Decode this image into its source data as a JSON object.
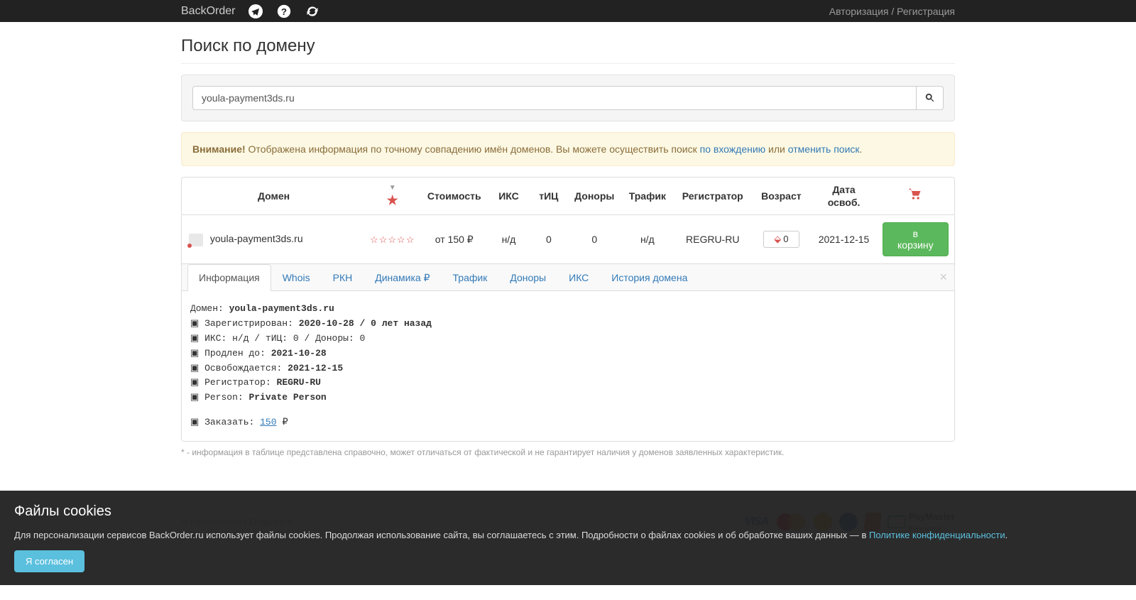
{
  "nav": {
    "brand": "BackOrder",
    "auth": "Авторизация",
    "reg": "Регистрация",
    "sep": " / "
  },
  "page": {
    "title": "Поиск по домену"
  },
  "search": {
    "value": "youla-payment3ds.ru"
  },
  "alert": {
    "strong": "Внимание!",
    "text1": " Отображена информация по точному совпадению имён доменов. Вы можете осуществить поиск ",
    "link1": "по вхождению",
    "text2": " или ",
    "link2": "отменить поиск",
    "dot": "."
  },
  "headers": {
    "domain": "Домен",
    "cost": "Стоимость",
    "iks": "ИКС",
    "tic": "тИЦ",
    "donors": "Доноры",
    "traffic": "Трафик",
    "registrar": "Регистратор",
    "age": "Возраст",
    "release": "Дата освоб."
  },
  "row": {
    "domain": "youla-payment3ds.ru",
    "stars": "☆☆☆☆☆",
    "cost": "от 150 ₽",
    "iks": "н/д",
    "tic": "0",
    "donors": "0",
    "traffic": "н/д",
    "registrar": "REGRU-RU",
    "age": "0",
    "release": "2021-12-15",
    "btn": "в корзину"
  },
  "tabs": {
    "info": "Информация",
    "whois": "Whois",
    "rkn": "РКН",
    "dyn": "Динамика ₽",
    "traffic": "Трафик",
    "donors": "Доноры",
    "iks": "ИКС",
    "history": "История домена"
  },
  "info": {
    "l1a": "Домен: ",
    "l1b": "youla-payment3ds.ru",
    "l2a": "▣ Зарегистрирован: ",
    "l2b": "2020-10-28 / 0 лет назад",
    "l3": "▣ ИКС: н/д / тИЦ: 0 / Доноры: 0",
    "l4a": "▣ Продлен до: ",
    "l4b": "2021-10-28",
    "l5a": "▣ Освобождается: ",
    "l5b": "2021-12-15",
    "l6a": "▣ Регистратор: ",
    "l6b": "REGRU-RU",
    "l7a": "▣ Person: ",
    "l7b": "Private Person",
    "l8a": "▣ Заказать: ",
    "l8b": "150",
    "l8c": " ₽"
  },
  "disclaimer": "* - информация в таблице представлена справочно, может отличаться от фактической и не гарантирует наличия у доменов заявленных характеристик.",
  "footer": {
    "copy": "© backorder.ru",
    "sep": "  /  ",
    "about": "О проекте",
    "paymaster": "PayMaster",
    "paymaster_sub": "Все в плюсе"
  },
  "cookies": {
    "title": "Файлы cookies",
    "text1": "Для персонализации сервисов BackOrder.ru использует файлы cookies. Продолжая использование сайта, вы соглашаетесь с этим. Подробности о файлах cookies и об обработке ваших данных — в ",
    "link": "Политике конфиденциальности",
    "dot": ".",
    "btn": "Я согласен"
  }
}
